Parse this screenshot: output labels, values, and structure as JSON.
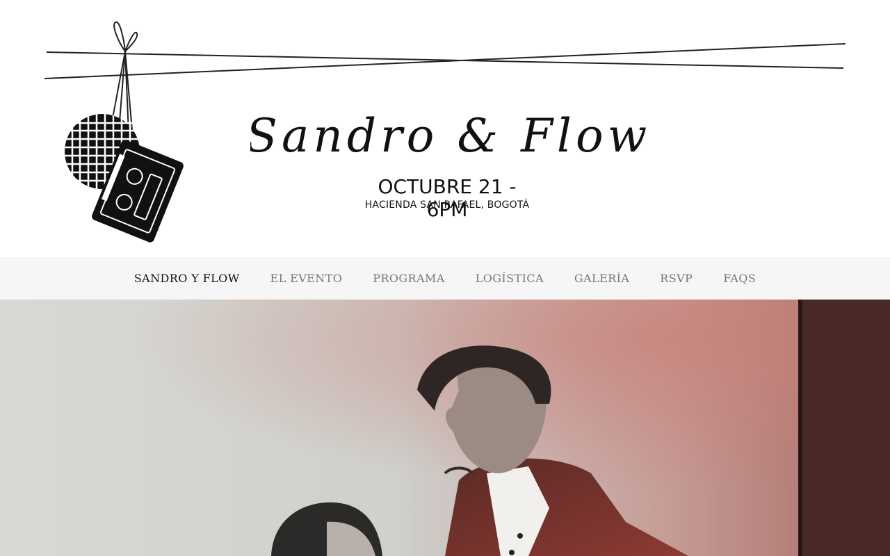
{
  "header": {
    "title": "Sandro & Flow",
    "date": "OCTUBRE 21 - 6PM",
    "venue": "HACIENDA SAN RAFAEL, BOGOTÁ",
    "logo_icons": [
      "disco-ball-icon",
      "cassette-tape-icon"
    ]
  },
  "nav": {
    "items": [
      {
        "label": "SANDRO Y FLOW",
        "active": true
      },
      {
        "label": "EL EVENTO",
        "active": false
      },
      {
        "label": "PROGRAMA",
        "active": false
      },
      {
        "label": "LOGÍSTICA",
        "active": false
      },
      {
        "label": "GALERÍA",
        "active": false
      },
      {
        "label": "RSVP",
        "active": false
      },
      {
        "label": "FAQS",
        "active": false
      }
    ]
  },
  "colors": {
    "nav_background": "#f6f6f6",
    "nav_active": "#111111",
    "nav_inactive": "#777777",
    "hero_tint": "#b04a48"
  }
}
